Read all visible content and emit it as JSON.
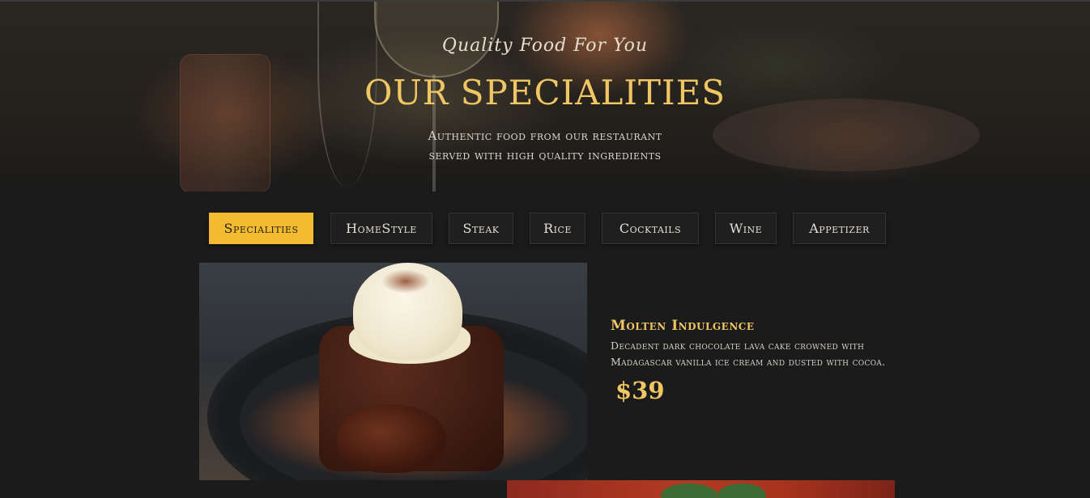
{
  "hero": {
    "tagline": "Quality Food For You",
    "title": "OUR SPECIALITIES",
    "description_lines": [
      "Authentic food from our restaurant",
      "served with high quality ingredients"
    ]
  },
  "tabs": [
    {
      "label": "Specialities",
      "active": true
    },
    {
      "label": "HomeStyle",
      "active": false
    },
    {
      "label": "Steak",
      "active": false
    },
    {
      "label": "Rice",
      "active": false
    },
    {
      "label": "Cocktails",
      "active": false
    },
    {
      "label": "Wine",
      "active": false
    },
    {
      "label": "Appetizer",
      "active": false
    }
  ],
  "featured_item": {
    "name": "Molten Indulgence",
    "description": "Decadent dark chocolate lava cake crowned with Madagascar vanilla ice cream and dusted with cocoa.",
    "price": "$39",
    "image_icon": "chocolate-lava-cake-photo"
  },
  "next_item": {
    "image_icon": "tomato-dish-photo"
  },
  "colors": {
    "background": "#1b1b1b",
    "accent_gold": "#f0c563",
    "active_tab": "#f2bb32",
    "tab_background": "#1f1f1f"
  }
}
